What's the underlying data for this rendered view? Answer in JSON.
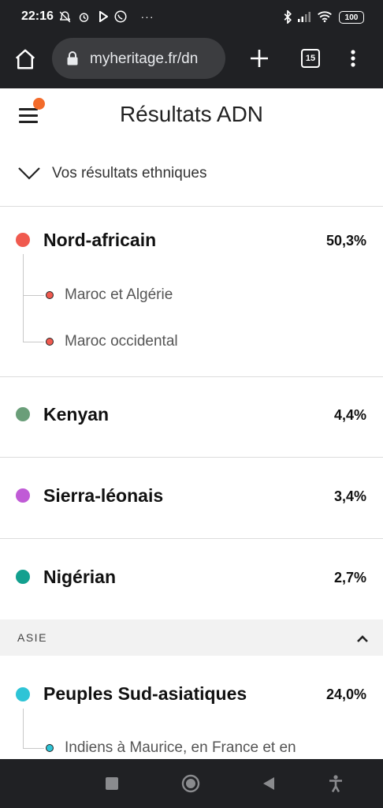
{
  "status_bar": {
    "time": "22:16",
    "icons": [
      "notifications-off-icon",
      "alarm-icon",
      "play-icon",
      "whatsapp-icon",
      "more-icon",
      "bluetooth-icon",
      "signal-icon",
      "wifi-icon"
    ],
    "battery": "100"
  },
  "browser": {
    "url": "myheritage.fr/dn",
    "tab_count": "15",
    "icons": [
      "home-icon",
      "lock-icon",
      "new-tab-icon",
      "tabs-icon",
      "overflow-menu-icon"
    ]
  },
  "app_header": {
    "title": "Résultats ADN",
    "notification_color": "#f36b2b"
  },
  "ethnic_toggle": {
    "label": "Vos résultats ethniques"
  },
  "ethnicities": [
    {
      "name": "Nord-africain",
      "percent": "50,3%",
      "color": "#f05a4f",
      "sub_regions": [
        {
          "name": "Maroc et Algérie",
          "color": "#f05a4f"
        },
        {
          "name": "Maroc occidental",
          "color": "#f05a4f"
        }
      ]
    },
    {
      "name": "Kenyan",
      "percent": "4,4%",
      "color": "#6a9e79"
    },
    {
      "name": "Sierra-léonais",
      "percent": "3,4%",
      "color": "#c05bd6"
    },
    {
      "name": "Nigérian",
      "percent": "2,7%",
      "color": "#13a08f"
    }
  ],
  "section": {
    "label": "ASIE"
  },
  "asia": [
    {
      "name": "Peuples Sud-asiatiques",
      "percent": "24,0%",
      "color": "#2ec4d6",
      "sub_regions": [
        {
          "name": "Indiens à Maurice, en France et en",
          "color": "#2ec4d6"
        }
      ]
    }
  ],
  "nav_bar": {
    "icons": [
      "recents-icon",
      "home-circle-icon",
      "back-icon",
      "accessibility-icon"
    ]
  }
}
